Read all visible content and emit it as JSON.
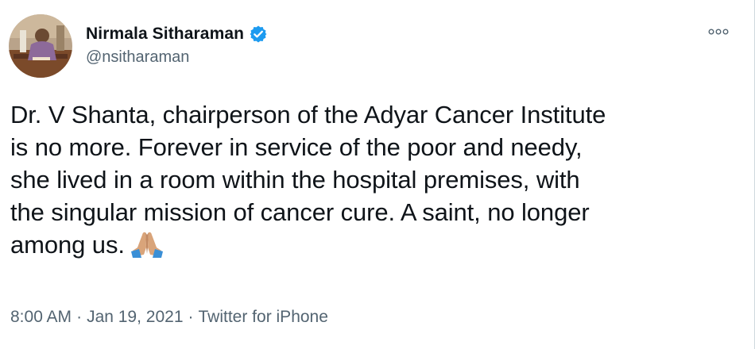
{
  "author": {
    "display_name": "Nirmala Sitharaman",
    "handle": "@nsitharaman",
    "verified": true
  },
  "tweet": {
    "text": "Dr. V Shanta, chairperson of the Adyar Cancer Institute\nis no more. Forever in service of the poor and needy,\nshe lived in a room within the hospital premises, with\nthe singular mission of cancer cure. A saint, no longer\namong us.",
    "emoji": "folded-hands-icon"
  },
  "meta": {
    "time": "8:00 AM",
    "separator": "·",
    "date": "Jan 19, 2021",
    "source": "Twitter for iPhone"
  },
  "colors": {
    "primary_text": "#0f1419",
    "secondary_text": "#536471",
    "verified_blue": "#1d9bf0"
  },
  "icons": {
    "verified": "verified-badge-icon",
    "more": "more-options-icon"
  }
}
